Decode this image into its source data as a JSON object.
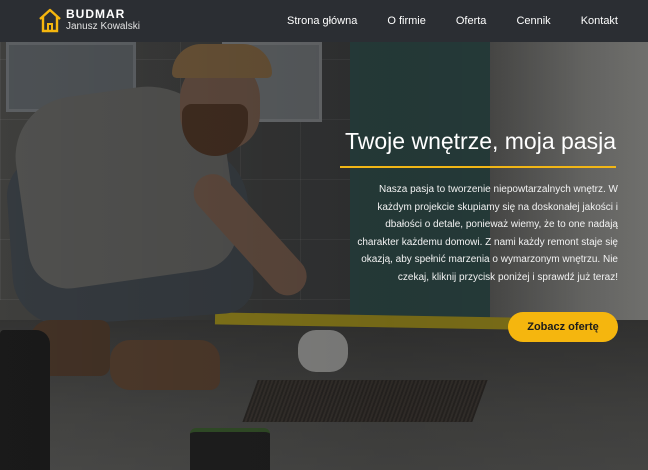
{
  "header": {
    "brand_name": "BUDMAR",
    "brand_sub": "Janusz Kowalski",
    "logo_icon": "house-icon",
    "nav": [
      {
        "label": "Strona główna"
      },
      {
        "label": "O firmie"
      },
      {
        "label": "Oferta"
      },
      {
        "label": "Cennik"
      },
      {
        "label": "Kontakt"
      }
    ]
  },
  "hero": {
    "title": "Twoje wnętrze, moja pasja",
    "text": "Nasza pasja to tworzenie niepowtarzalnych wnętrz. W każdym projekcie skupiamy się na doskonałej jakości i dbałości o detale, ponieważ wiemy, że to one nadają charakter każdemu domowi. Z nami każdy remont staje się okazją, aby spełnić marzenia o wymarzonym wnętrzu. Nie czekaj, kliknij przycisk poniżej i sprawdź już teraz!",
    "cta_label": "Zobacz ofertę"
  },
  "colors": {
    "accent": "#f5b60e",
    "navbar": "#2b2e33"
  }
}
